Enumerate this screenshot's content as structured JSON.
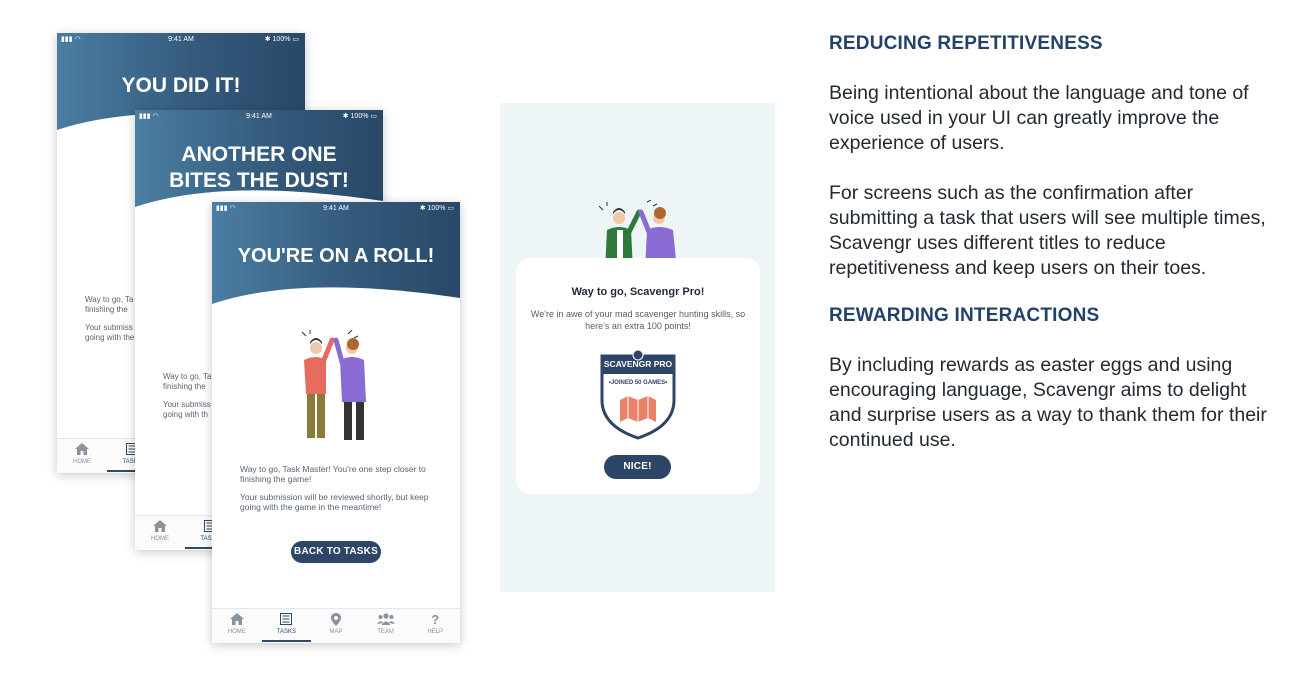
{
  "status_bar": {
    "time": "9:41 AM",
    "battery": "100%"
  },
  "screens": [
    {
      "headline": "YOU DID IT!",
      "body_lines": [
        "Way to go, Ta",
        "finishing the"
      ],
      "body_lines2": [
        "Your submiss",
        "going with the"
      ],
      "tabs": [
        "HOME",
        "TASKS"
      ]
    },
    {
      "headline_lines": [
        "ANOTHER ONE",
        "BITES THE DUST!"
      ],
      "body_lines": [
        "Way to go, Ta",
        "finishing the"
      ],
      "body_lines2": [
        "Your submiss",
        "going with th"
      ],
      "tabs": [
        "HOME",
        "TASKS"
      ]
    },
    {
      "headline": "YOU'RE ON A ROLL!",
      "body_p1": "Way to go, Task Master! You're one step closer to finishing the game!",
      "body_p2": "Your submission will be reviewed shortly, but keep going with the game in the meantime!",
      "button": "BACK TO TASKS",
      "tabs": [
        "HOME",
        "TASKS",
        "MAP",
        "TEAM",
        "HELP"
      ]
    }
  ],
  "reward_card": {
    "title": "Way to go, Scavengr Pro!",
    "text": "We're in awe of your mad scavenger hunting skills, so here's an extra 100 points!",
    "badge_title": "SCAVENGR PRO",
    "badge_sub": "•JOINED 50 GAMES•",
    "button": "NICE!"
  },
  "sections": [
    {
      "title": "REDUCING REPETITIVENESS",
      "paragraphs": [
        "Being intentional about the language and tone of voice used in your UI can greatly improve the experience of users.",
        "For screens such as the confirmation after submitting a task that users will see multiple times, Scavengr uses different titles to reduce repetitiveness and keep users on their toes."
      ]
    },
    {
      "title": "REWARDING INTERACTIONS",
      "paragraphs": [
        "By including rewards as easter eggs and using encouraging language, Scavengr aims to delight and surprise users as a way to thank them for their continued use."
      ]
    }
  ],
  "colors": {
    "accent": "#2d4566",
    "header_start": "#4a7ea2",
    "header_end": "#2a4868",
    "section_title": "#24416a"
  }
}
